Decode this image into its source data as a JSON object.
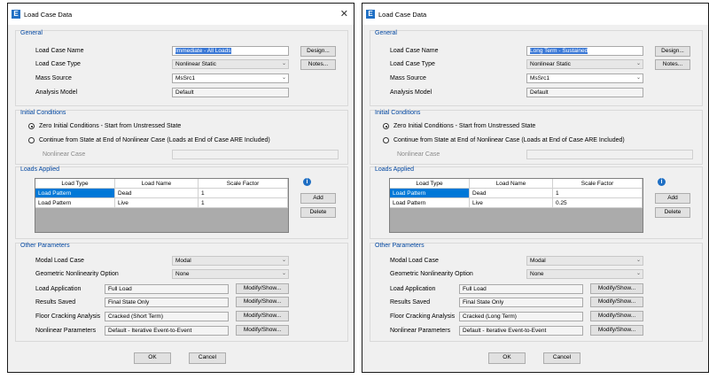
{
  "dialogs": [
    {
      "title": "Load Case Data",
      "general": {
        "title": "General",
        "load_case_name_label": "Load Case Name",
        "load_case_name_value": "Immediate - All Loads",
        "load_case_type_label": "Load Case Type",
        "load_case_type_value": "Nonlinear Static",
        "mass_source_label": "Mass Source",
        "mass_source_value": "MsSrc1",
        "analysis_model_label": "Analysis Model",
        "analysis_model_value": "Default",
        "design_button": "Design...",
        "notes_button": "Notes..."
      },
      "initial_conditions": {
        "title": "Initial Conditions",
        "option_zero": "Zero Initial Conditions - Start from Unstressed State",
        "option_continue": "Continue from State at End of Nonlinear Case  (Loads at End of Case ARE Included)",
        "nonlinear_case_label": "Nonlinear Case"
      },
      "loads_applied": {
        "title": "Loads Applied",
        "headers": [
          "Load Type",
          "Load Name",
          "Scale Factor"
        ],
        "rows": [
          {
            "type": "Load Pattern",
            "name": "Dead",
            "factor": "1"
          },
          {
            "type": "Load Pattern",
            "name": "Live",
            "factor": "1"
          }
        ],
        "add_button": "Add",
        "delete_button": "Delete"
      },
      "other_parameters": {
        "title": "Other Parameters",
        "modal_load_case_label": "Modal Load Case",
        "modal_load_case_value": "Modal",
        "geometric_label": "Geometric Nonlinearity Option",
        "geometric_value": "None",
        "load_application_label": "Load Application",
        "load_application_value": "Full Load",
        "results_saved_label": "Results Saved",
        "results_saved_value": "Final State Only",
        "floor_cracking_label": "Floor Cracking Analysis",
        "floor_cracking_value": "Cracked (Short Term)",
        "nonlinear_params_label": "Nonlinear Parameters",
        "nonlinear_params_value": "Default - Iterative Event-to-Event",
        "modify_show": "Modify/Show..."
      },
      "ok_button": "OK",
      "cancel_button": "Cancel"
    },
    {
      "title": "Load Case Data",
      "general": {
        "title": "General",
        "load_case_name_label": "Load Case Name",
        "load_case_name_value": "Long Term - Sustained",
        "load_case_type_label": "Load Case Type",
        "load_case_type_value": "Nonlinear Static",
        "mass_source_label": "Mass Source",
        "mass_source_value": "MsSrc1",
        "analysis_model_label": "Analysis Model",
        "analysis_model_value": "Default",
        "design_button": "Design...",
        "notes_button": "Notes..."
      },
      "initial_conditions": {
        "title": "Initial Conditions",
        "option_zero": "Zero Initial Conditions - Start from Unstressed State",
        "option_continue": "Continue from State at End of Nonlinear Case  (Loads at End of Case ARE Included)",
        "nonlinear_case_label": "Nonlinear Case"
      },
      "loads_applied": {
        "title": "Loads Applied",
        "headers": [
          "Load Type",
          "Load Name",
          "Scale Factor"
        ],
        "rows": [
          {
            "type": "Load Pattern",
            "name": "Dead",
            "factor": "1"
          },
          {
            "type": "Load Pattern",
            "name": "Live",
            "factor": "0.25"
          }
        ],
        "add_button": "Add",
        "delete_button": "Delete"
      },
      "other_parameters": {
        "title": "Other Parameters",
        "modal_load_case_label": "Modal Load Case",
        "modal_load_case_value": "Modal",
        "geometric_label": "Geometric Nonlinearity Option",
        "geometric_value": "None",
        "load_application_label": "Load Application",
        "load_application_value": "Full Load",
        "results_saved_label": "Results Saved",
        "results_saved_value": "Final State Only",
        "floor_cracking_label": "Floor Cracking Analysis",
        "floor_cracking_value": "Cracked (Long Term)",
        "nonlinear_params_label": "Nonlinear Parameters",
        "nonlinear_params_value": "Default - Iterative Event-to-Event",
        "modify_show": "Modify/Show..."
      },
      "ok_button": "OK",
      "cancel_button": "Cancel"
    }
  ],
  "icons": {
    "app": "etabs-app-icon",
    "close": "close-icon",
    "info": "info-icon",
    "dropdown": "chevron-down-icon"
  }
}
